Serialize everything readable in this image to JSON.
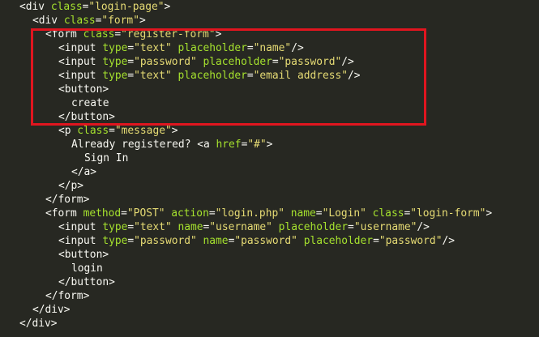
{
  "code_lines": [
    {
      "indent": 1,
      "tokens": [
        {
          "t": "tag",
          "v": "<div "
        },
        {
          "t": "attr",
          "v": "class"
        },
        {
          "t": "tag",
          "v": "="
        },
        {
          "t": "str",
          "v": "\"login-page\""
        },
        {
          "t": "tag",
          "v": ">"
        }
      ]
    },
    {
      "indent": 2,
      "tokens": [
        {
          "t": "tag",
          "v": "<div "
        },
        {
          "t": "attr",
          "v": "class"
        },
        {
          "t": "tag",
          "v": "="
        },
        {
          "t": "str",
          "v": "\"form\""
        },
        {
          "t": "tag",
          "v": ">"
        }
      ]
    },
    {
      "indent": 3,
      "tokens": [
        {
          "t": "tag",
          "v": "<form "
        },
        {
          "t": "attr",
          "v": "class"
        },
        {
          "t": "tag",
          "v": "="
        },
        {
          "t": "str",
          "v": "\"register-form\""
        },
        {
          "t": "tag",
          "v": ">"
        }
      ]
    },
    {
      "indent": 4,
      "tokens": [
        {
          "t": "tag",
          "v": "<input "
        },
        {
          "t": "attr",
          "v": "type"
        },
        {
          "t": "tag",
          "v": "="
        },
        {
          "t": "str",
          "v": "\"text\""
        },
        {
          "t": "tag",
          "v": " "
        },
        {
          "t": "attr",
          "v": "placeholder"
        },
        {
          "t": "tag",
          "v": "="
        },
        {
          "t": "str",
          "v": "\"name\""
        },
        {
          "t": "tag",
          "v": "/>"
        }
      ]
    },
    {
      "indent": 4,
      "tokens": [
        {
          "t": "tag",
          "v": "<input "
        },
        {
          "t": "attr",
          "v": "type"
        },
        {
          "t": "tag",
          "v": "="
        },
        {
          "t": "str",
          "v": "\"password\""
        },
        {
          "t": "tag",
          "v": " "
        },
        {
          "t": "attr",
          "v": "placeholder"
        },
        {
          "t": "tag",
          "v": "="
        },
        {
          "t": "str",
          "v": "\"password\""
        },
        {
          "t": "tag",
          "v": "/>"
        }
      ]
    },
    {
      "indent": 4,
      "tokens": [
        {
          "t": "tag",
          "v": "<input "
        },
        {
          "t": "attr",
          "v": "type"
        },
        {
          "t": "tag",
          "v": "="
        },
        {
          "t": "str",
          "v": "\"text\""
        },
        {
          "t": "tag",
          "v": " "
        },
        {
          "t": "attr",
          "v": "placeholder"
        },
        {
          "t": "tag",
          "v": "="
        },
        {
          "t": "str",
          "v": "\"email address\""
        },
        {
          "t": "tag",
          "v": "/>"
        }
      ]
    },
    {
      "indent": 4,
      "tokens": [
        {
          "t": "tag",
          "v": "<button>"
        }
      ]
    },
    {
      "indent": 5,
      "tokens": [
        {
          "t": "txt",
          "v": "create"
        }
      ]
    },
    {
      "indent": 4,
      "tokens": [
        {
          "t": "tag",
          "v": "</button>"
        }
      ]
    },
    {
      "indent": 4,
      "tokens": [
        {
          "t": "tag",
          "v": "<p "
        },
        {
          "t": "attr",
          "v": "class"
        },
        {
          "t": "tag",
          "v": "="
        },
        {
          "t": "str",
          "v": "\"message\""
        },
        {
          "t": "tag",
          "v": ">"
        }
      ]
    },
    {
      "indent": 5,
      "tokens": [
        {
          "t": "txt",
          "v": "Already registered? "
        },
        {
          "t": "tag",
          "v": "<a "
        },
        {
          "t": "attr",
          "v": "href"
        },
        {
          "t": "tag",
          "v": "="
        },
        {
          "t": "str",
          "v": "\"#\""
        },
        {
          "t": "tag",
          "v": ">"
        }
      ]
    },
    {
      "indent": 6,
      "tokens": [
        {
          "t": "txt",
          "v": "Sign In"
        }
      ]
    },
    {
      "indent": 5,
      "tokens": [
        {
          "t": "tag",
          "v": "</a>"
        }
      ]
    },
    {
      "indent": 4,
      "tokens": [
        {
          "t": "tag",
          "v": "</p>"
        }
      ]
    },
    {
      "indent": 3,
      "tokens": [
        {
          "t": "tag",
          "v": "</form>"
        }
      ]
    },
    {
      "indent": 3,
      "tokens": [
        {
          "t": "tag",
          "v": "<form "
        },
        {
          "t": "attr",
          "v": "method"
        },
        {
          "t": "tag",
          "v": "="
        },
        {
          "t": "str",
          "v": "\"POST\""
        },
        {
          "t": "tag",
          "v": " "
        },
        {
          "t": "attr",
          "v": "action"
        },
        {
          "t": "tag",
          "v": "="
        },
        {
          "t": "str",
          "v": "\"login.php\""
        },
        {
          "t": "tag",
          "v": " "
        },
        {
          "t": "attr",
          "v": "name"
        },
        {
          "t": "tag",
          "v": "="
        },
        {
          "t": "str",
          "v": "\"Login\""
        },
        {
          "t": "tag",
          "v": " "
        },
        {
          "t": "attr",
          "v": "class"
        },
        {
          "t": "tag",
          "v": "="
        },
        {
          "t": "str",
          "v": "\"login-form\""
        },
        {
          "t": "tag",
          "v": ">"
        }
      ]
    },
    {
      "indent": 4,
      "tokens": [
        {
          "t": "tag",
          "v": "<input "
        },
        {
          "t": "attr",
          "v": "type"
        },
        {
          "t": "tag",
          "v": "="
        },
        {
          "t": "str",
          "v": "\"text\""
        },
        {
          "t": "tag",
          "v": " "
        },
        {
          "t": "attr",
          "v": "name"
        },
        {
          "t": "tag",
          "v": "="
        },
        {
          "t": "str",
          "v": "\"username\""
        },
        {
          "t": "tag",
          "v": " "
        },
        {
          "t": "attr",
          "v": "placeholder"
        },
        {
          "t": "tag",
          "v": "="
        },
        {
          "t": "str",
          "v": "\"username\""
        },
        {
          "t": "tag",
          "v": "/>"
        }
      ]
    },
    {
      "indent": 4,
      "tokens": [
        {
          "t": "tag",
          "v": "<input "
        },
        {
          "t": "attr",
          "v": "type"
        },
        {
          "t": "tag",
          "v": "="
        },
        {
          "t": "str",
          "v": "\"password\""
        },
        {
          "t": "tag",
          "v": " "
        },
        {
          "t": "attr",
          "v": "name"
        },
        {
          "t": "tag",
          "v": "="
        },
        {
          "t": "str",
          "v": "\"password\""
        },
        {
          "t": "tag",
          "v": " "
        },
        {
          "t": "attr",
          "v": "placeholder"
        },
        {
          "t": "tag",
          "v": "="
        },
        {
          "t": "str",
          "v": "\"password\""
        },
        {
          "t": "tag",
          "v": "/>"
        }
      ]
    },
    {
      "indent": 4,
      "tokens": [
        {
          "t": "tag",
          "v": "<button>"
        }
      ]
    },
    {
      "indent": 5,
      "tokens": [
        {
          "t": "txt",
          "v": "login"
        }
      ]
    },
    {
      "indent": 4,
      "tokens": [
        {
          "t": "tag",
          "v": "</button>"
        }
      ]
    },
    {
      "indent": 3,
      "tokens": [
        {
          "t": "tag",
          "v": "</form>"
        }
      ]
    },
    {
      "indent": 2,
      "tokens": [
        {
          "t": "tag",
          "v": "</div>"
        }
      ]
    },
    {
      "indent": 1,
      "tokens": [
        {
          "t": "tag",
          "v": "</div>"
        }
      ]
    }
  ],
  "colors": {
    "background": "#272822",
    "tag": "#f8f8f2",
    "attribute": "#a6e22e",
    "string": "#e6db74",
    "highlight_border": "#e0151f"
  }
}
